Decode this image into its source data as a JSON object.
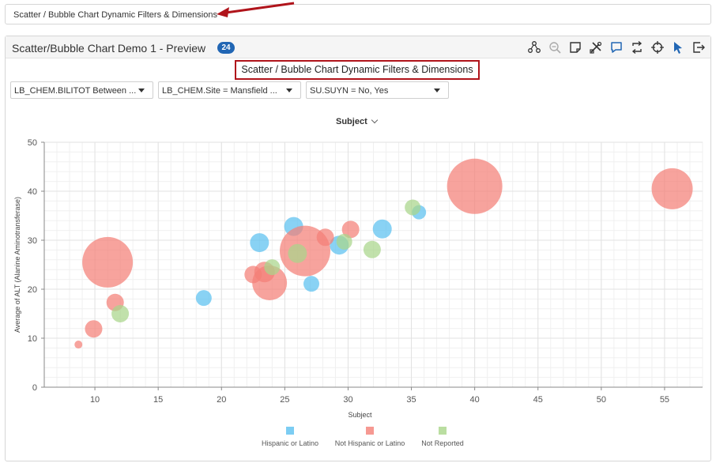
{
  "top_bar": {
    "text": "Scatter / Bubble Chart Dynamic Filters & Dimensions"
  },
  "panel": {
    "title": "Scatter/Bubble Chart Demo 1 - Preview",
    "badge": "24",
    "chart_title": "Scatter / Bubble Chart Dynamic Filters & Dimensions",
    "toolbar": [
      "hierarchy-icon",
      "zoom-out-icon",
      "note-icon",
      "tools-icon",
      "comment-icon",
      "refresh-icon",
      "crosshair-icon",
      "pointer-icon",
      "export-icon"
    ]
  },
  "filters": [
    {
      "label": "LB_CHEM.BILITOT Between ..."
    },
    {
      "label": "LB_CHEM.Site = Mansfield ..."
    },
    {
      "label": "SU.SUYN = No, Yes"
    }
  ],
  "dimension": {
    "label": "Subject"
  },
  "colors": {
    "accent": "#2166b4",
    "highlight": "#b0141b",
    "hispanic": "#5bc1f0",
    "not_hispanic": "#f47f77",
    "not_reported": "#a9d68a"
  },
  "chart_data": {
    "type": "scatter",
    "xlabel": "Subject",
    "ylabel": "Average of ALT (Alanine Aminotransferase)",
    "xlim": [
      6,
      58
    ],
    "ylim": [
      0,
      50
    ],
    "xticks": [
      10,
      15,
      20,
      25,
      30,
      35,
      40,
      45,
      50,
      55
    ],
    "yticks": [
      0,
      10,
      20,
      30,
      40,
      50
    ],
    "grid": true,
    "legend_position": "bottom",
    "series": [
      {
        "name": "Hispanic or Latino",
        "color": "#5bc1f0",
        "points": [
          {
            "x": 18.6,
            "y": 18.2,
            "size": 1.0
          },
          {
            "x": 23.0,
            "y": 29.5,
            "size": 1.2
          },
          {
            "x": 25.7,
            "y": 32.8,
            "size": 1.2
          },
          {
            "x": 27.1,
            "y": 21.1,
            "size": 1.0
          },
          {
            "x": 29.3,
            "y": 29.0,
            "size": 1.2
          },
          {
            "x": 32.7,
            "y": 32.3,
            "size": 1.2
          },
          {
            "x": 35.6,
            "y": 35.7,
            "size": 0.9
          }
        ]
      },
      {
        "name": "Not Hispanic or Latino",
        "color": "#f47f77",
        "points": [
          {
            "x": 8.7,
            "y": 8.7,
            "size": 0.5
          },
          {
            "x": 9.9,
            "y": 11.9,
            "size": 1.1
          },
          {
            "x": 11.0,
            "y": 25.5,
            "size": 3.2
          },
          {
            "x": 11.6,
            "y": 17.3,
            "size": 1.1
          },
          {
            "x": 22.5,
            "y": 23.0,
            "size": 1.1
          },
          {
            "x": 23.4,
            "y": 23.5,
            "size": 1.3
          },
          {
            "x": 23.8,
            "y": 21.3,
            "size": 2.2
          },
          {
            "x": 26.6,
            "y": 27.8,
            "size": 3.2
          },
          {
            "x": 28.2,
            "y": 30.6,
            "size": 1.1
          },
          {
            "x": 30.2,
            "y": 32.2,
            "size": 1.1
          },
          {
            "x": 40.0,
            "y": 41.0,
            "size": 3.5
          },
          {
            "x": 55.6,
            "y": 40.5,
            "size": 2.6
          }
        ]
      },
      {
        "name": "Not Reported",
        "color": "#a9d68a",
        "points": [
          {
            "x": 12.0,
            "y": 15.0,
            "size": 1.1
          },
          {
            "x": 24.0,
            "y": 24.5,
            "size": 1.0
          },
          {
            "x": 26.0,
            "y": 27.3,
            "size": 1.2
          },
          {
            "x": 29.7,
            "y": 29.7,
            "size": 1.0
          },
          {
            "x": 31.9,
            "y": 28.1,
            "size": 1.1
          },
          {
            "x": 35.1,
            "y": 36.7,
            "size": 1.0
          }
        ]
      }
    ]
  }
}
